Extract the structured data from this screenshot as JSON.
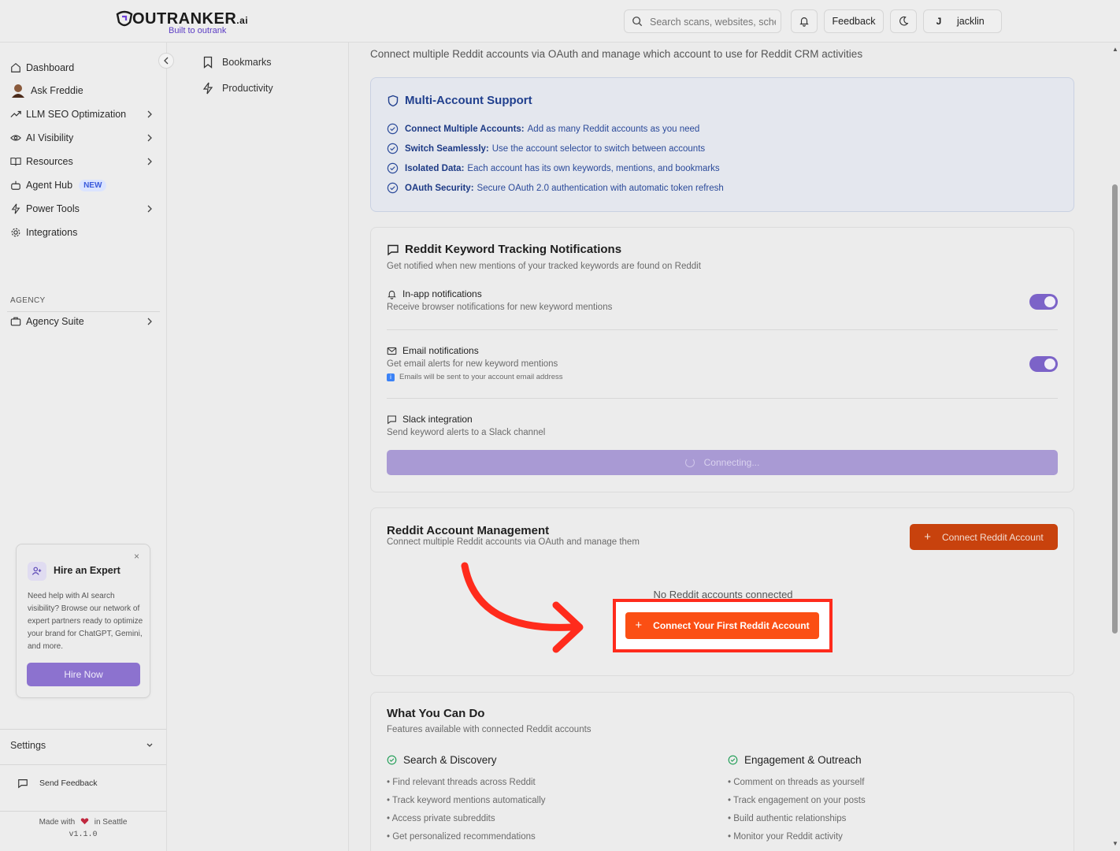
{
  "header": {
    "logo_text": "OUTRANKER",
    "logo_suffix": ".ai",
    "logo_tagline": "Built to outrank",
    "search_placeholder": "Search scans, websites, schedules...",
    "feedback_label": "Feedback",
    "user_initial": "J",
    "user_name": "jacklin"
  },
  "sidebar": {
    "items": [
      {
        "label": "Dashboard",
        "icon": "home-icon"
      },
      {
        "label": "Ask Freddie",
        "icon": "avatar-icon"
      },
      {
        "label": "LLM SEO Optimization",
        "icon": "trend-icon"
      },
      {
        "label": "AI Visibility",
        "icon": "eye-icon"
      },
      {
        "label": "Resources",
        "icon": "book-icon"
      },
      {
        "label": "Agent Hub",
        "icon": "bot-icon",
        "badge": "NEW"
      },
      {
        "label": "Power Tools",
        "icon": "zap-icon"
      },
      {
        "label": "Integrations",
        "icon": "cog-icon"
      }
    ],
    "section_label": "AGENCY",
    "agency_item": "Agency Suite",
    "promo": {
      "title": "Hire an Expert",
      "text": "Need help with AI search visibility? Browse our network of expert partners ready to optimize your brand for ChatGPT, Gemini, and more.",
      "button": "Hire Now",
      "close": "×"
    },
    "settings_label": "Settings",
    "send_feedback": "Send Feedback",
    "made_with_prefix": "Made with",
    "made_with_suffix": "in Seattle",
    "version": "v1.1.0"
  },
  "subpanel": {
    "items": [
      {
        "label": "Bookmarks",
        "icon": "bookmark-icon"
      },
      {
        "label": "Productivity",
        "icon": "zap-icon"
      }
    ]
  },
  "main": {
    "intro": "Connect multiple Reddit accounts via OAuth and manage which account to use for Reddit CRM activities",
    "multi_account": {
      "title": "Multi-Account Support",
      "rows": [
        {
          "bold": "Connect Multiple Accounts:",
          "text": "Add as many Reddit accounts as you need"
        },
        {
          "bold": "Switch Seamlessly:",
          "text": "Use the account selector to switch between accounts"
        },
        {
          "bold": "Isolated Data:",
          "text": "Each account has its own keywords, mentions, and bookmarks"
        },
        {
          "bold": "OAuth Security:",
          "text": "Secure OAuth 2.0 authentication with automatic token refresh"
        }
      ]
    },
    "notifications": {
      "title": "Reddit Keyword Tracking Notifications",
      "subtitle": "Get notified when new mentions of your tracked keywords are found on Reddit",
      "inapp_title": "In-app notifications",
      "inapp_sub": "Receive browser notifications for new keyword mentions",
      "inapp_enabled": true,
      "email_title": "Email notifications",
      "email_sub": "Get email alerts for new keyword mentions",
      "email_note": "Emails will be sent to your account email address",
      "email_enabled": true,
      "slack_title": "Slack integration",
      "slack_sub": "Send keyword alerts to a Slack channel",
      "connecting_label": "Connecting..."
    },
    "account_mgmt": {
      "title": "Reddit Account Management",
      "subtitle": "Connect multiple Reddit accounts via OAuth and manage them",
      "connect_button": "Connect Reddit Account",
      "empty_text": "No Reddit accounts connected",
      "first_button": "Connect Your First Reddit Account"
    },
    "what_you_can_do": {
      "title": "What You Can Do",
      "subtitle": "Features available with connected Reddit accounts",
      "left_heading": "Search & Discovery",
      "left_items": [
        "• Find relevant threads across Reddit",
        "• Track keyword mentions automatically",
        "• Access private subreddits",
        "• Get personalized recommendations"
      ],
      "right_heading": "Engagement & Outreach",
      "right_items": [
        "• Comment on threads as yourself",
        "• Track engagement on your posts",
        "• Build authentic relationships",
        "• Monitor your Reddit activity"
      ]
    }
  },
  "colors": {
    "accent_purple": "#7c63c8",
    "orange": "#c8420d",
    "highlight_red": "#ff2b1c",
    "primary_orange": "#fb4f14",
    "blue_text": "#21408e"
  }
}
